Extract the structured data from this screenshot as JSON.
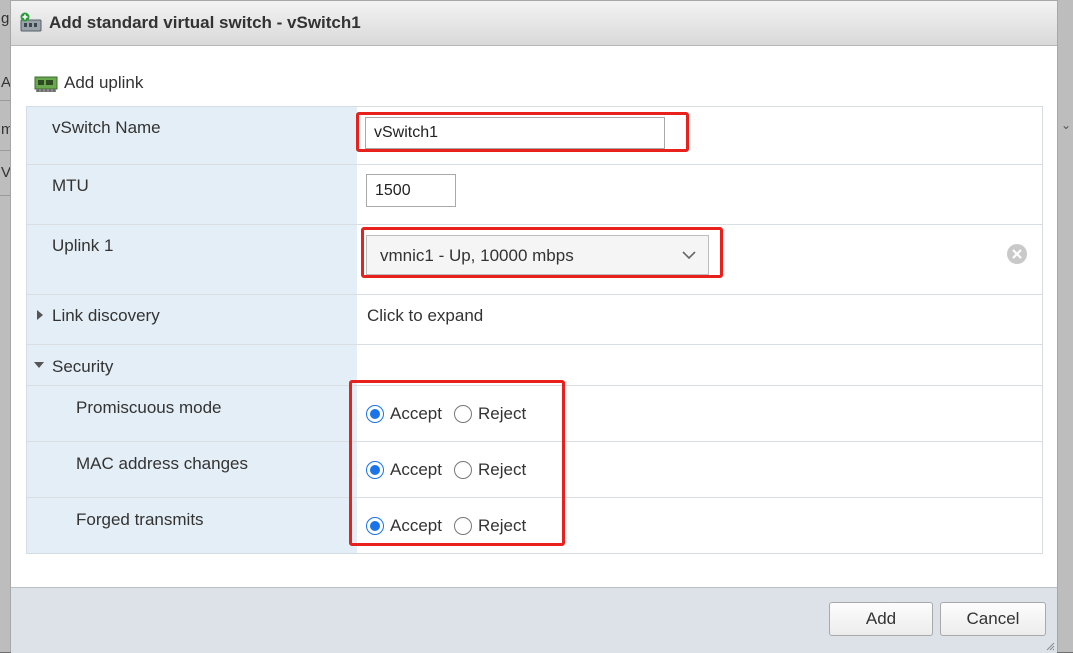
{
  "background": {
    "left_chars": [
      "g",
      "A",
      "m",
      "V"
    ]
  },
  "dialog": {
    "title": "Add standard virtual switch - vSwitch1",
    "title_icon": "add-switch-icon"
  },
  "toolbar": {
    "add_uplink_label": "Add uplink",
    "add_uplink_icon": "network-card-icon"
  },
  "form": {
    "vswitch_name": {
      "label": "vSwitch Name",
      "value": "vSwitch1"
    },
    "mtu": {
      "label": "MTU",
      "value": "1500"
    },
    "uplink1": {
      "label": "Uplink 1",
      "selected": "vmnic1 - Up, 10000 mbps"
    },
    "link_discovery": {
      "label": "Link discovery",
      "value": "Click to expand"
    },
    "security": {
      "label": "Security",
      "promiscuous_mode": {
        "label": "Promiscuous mode",
        "accept": "Accept",
        "reject": "Reject",
        "selected": "Accept"
      },
      "mac_address_changes": {
        "label": "MAC address changes",
        "accept": "Accept",
        "reject": "Reject",
        "selected": "Accept"
      },
      "forged_transmits": {
        "label": "Forged transmits",
        "accept": "Accept",
        "reject": "Reject",
        "selected": "Accept"
      }
    }
  },
  "buttons": {
    "add": "Add",
    "cancel": "Cancel"
  },
  "colors": {
    "highlight": "#e8211d",
    "label_bg": "#e4eef6",
    "radio_selected": "#1a73e8",
    "footer_bg": "#dde2e8"
  }
}
